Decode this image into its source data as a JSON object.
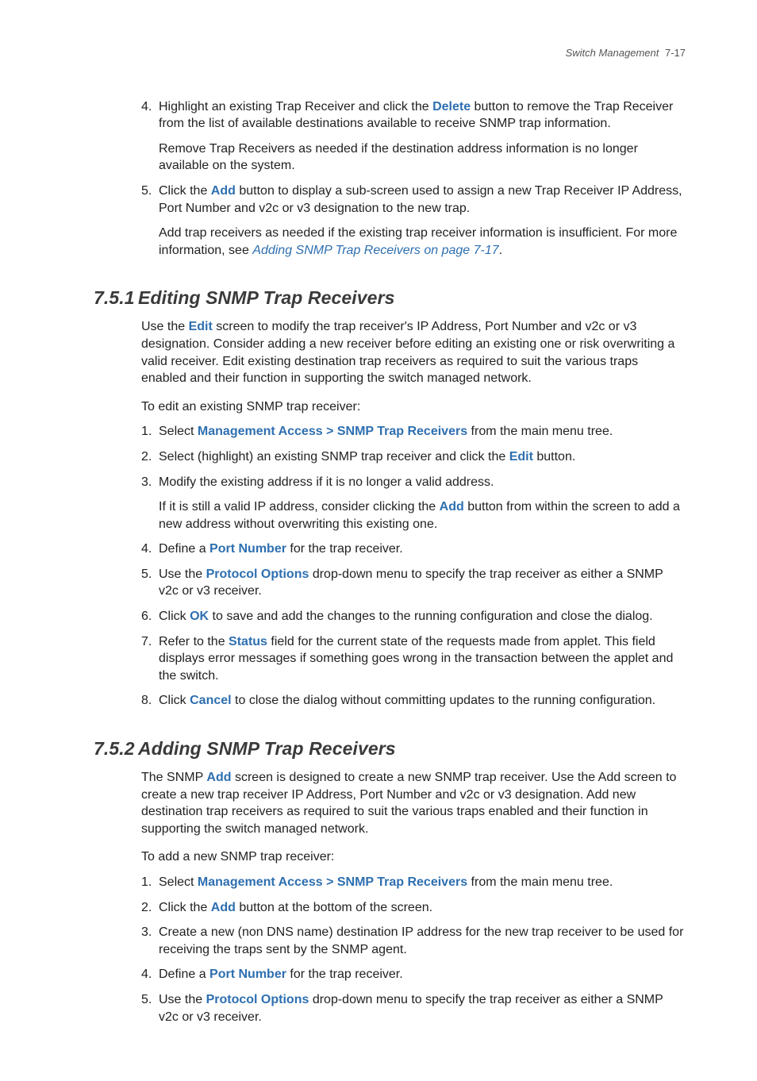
{
  "header": {
    "title": "Switch Management",
    "page": "7-17"
  },
  "topList": {
    "items": [
      {
        "num": "4.",
        "paragraphs": [
          [
            {
              "t": "Highlight an existing Trap Receiver and click the "
            },
            {
              "t": "Delete",
              "kw": true
            },
            {
              "t": " button to remove the Trap Receiver from the list of available destinations available to receive SNMP trap information."
            }
          ],
          [
            {
              "t": "Remove Trap Receivers as needed if the destination address information is no longer available on the system."
            }
          ]
        ]
      },
      {
        "num": "5.",
        "paragraphs": [
          [
            {
              "t": "Click the "
            },
            {
              "t": "Add",
              "kw": true
            },
            {
              "t": " button to display a sub-screen used to assign a new Trap Receiver IP Address, Port Number and v2c or v3 designation to the new trap."
            }
          ],
          [
            {
              "t": "Add trap receivers as needed if the existing trap receiver information is insufficient. For more information, see "
            },
            {
              "t": "Adding SNMP Trap Receivers on page 7-17",
              "xref": true
            },
            {
              "t": "."
            }
          ]
        ]
      }
    ]
  },
  "sec751": {
    "num": "7.5.1",
    "title": "Editing SNMP Trap Receivers",
    "leadSegs": [
      {
        "t": "Use the "
      },
      {
        "t": "Edit",
        "kw": true
      },
      {
        "t": " screen to modify the trap receiver's IP Address, Port Number and v2c or v3 designation. Consider adding a new receiver before editing an existing one or risk overwriting a valid receiver. Edit existing destination trap receivers as required to suit the various traps enabled and their function in supporting the switch managed network."
      }
    ],
    "intro": "To edit an existing SNMP trap receiver:",
    "items": [
      {
        "num": "1.",
        "paragraphs": [
          [
            {
              "t": "Select "
            },
            {
              "t": "Management Access > SNMP Trap Receivers",
              "kw": true
            },
            {
              "t": " from the main menu tree."
            }
          ]
        ]
      },
      {
        "num": "2.",
        "paragraphs": [
          [
            {
              "t": "Select (highlight) an existing SNMP trap receiver and click the "
            },
            {
              "t": "Edit",
              "kw": true
            },
            {
              "t": " button."
            }
          ]
        ]
      },
      {
        "num": "3.",
        "paragraphs": [
          [
            {
              "t": "Modify the existing address if it is no longer a valid address."
            }
          ],
          [
            {
              "t": "If it is still a valid IP address, consider clicking the "
            },
            {
              "t": "Add",
              "kw": true
            },
            {
              "t": " button from within the screen to add a new address without overwriting this existing one."
            }
          ]
        ]
      },
      {
        "num": "4.",
        "paragraphs": [
          [
            {
              "t": "Define a "
            },
            {
              "t": "Port Number",
              "kw": true
            },
            {
              "t": " for the trap receiver."
            }
          ]
        ]
      },
      {
        "num": "5.",
        "paragraphs": [
          [
            {
              "t": "Use the "
            },
            {
              "t": "Protocol Options",
              "kw": true
            },
            {
              "t": " drop-down menu to specify the trap receiver as either a SNMP v2c or v3 receiver."
            }
          ]
        ]
      },
      {
        "num": "6.",
        "paragraphs": [
          [
            {
              "t": "Click "
            },
            {
              "t": "OK",
              "kw": true
            },
            {
              "t": " to save and add the changes to the running configuration and close the dialog."
            }
          ]
        ]
      },
      {
        "num": "7.",
        "paragraphs": [
          [
            {
              "t": "Refer to the "
            },
            {
              "t": "Status",
              "kw": true
            },
            {
              "t": " field for the current state of the requests made from applet. This field displays error messages if something goes wrong in the transaction between the applet and the switch."
            }
          ]
        ]
      },
      {
        "num": "8.",
        "paragraphs": [
          [
            {
              "t": "Click "
            },
            {
              "t": "Cancel",
              "kw": true
            },
            {
              "t": " to close the dialog without committing updates to the running configuration."
            }
          ]
        ]
      }
    ]
  },
  "sec752": {
    "num": "7.5.2",
    "title": "Adding SNMP Trap Receivers",
    "leadSegs": [
      {
        "t": "The SNMP "
      },
      {
        "t": "Add",
        "kw": true
      },
      {
        "t": " screen is designed to create a new SNMP trap receiver. Use the Add screen to create a new trap receiver IP Address, Port Number and v2c or v3 designation. Add new destination trap receivers as required to suit the various traps enabled and their function in supporting the switch managed network."
      }
    ],
    "intro": "To add a new SNMP trap receiver:",
    "items": [
      {
        "num": "1.",
        "paragraphs": [
          [
            {
              "t": "Select "
            },
            {
              "t": "Management Access > SNMP Trap Receivers",
              "kw": true
            },
            {
              "t": " from the main menu tree."
            }
          ]
        ]
      },
      {
        "num": "2.",
        "paragraphs": [
          [
            {
              "t": "Click the "
            },
            {
              "t": "Add",
              "kw": true
            },
            {
              "t": " button at the bottom of the screen."
            }
          ]
        ]
      },
      {
        "num": "3.",
        "paragraphs": [
          [
            {
              "t": "Create a new (non DNS name) destination IP address for the new trap receiver to be used for receiving the traps sent by the SNMP agent."
            }
          ]
        ]
      },
      {
        "num": "4.",
        "paragraphs": [
          [
            {
              "t": "Define a "
            },
            {
              "t": "Port Number",
              "kw": true
            },
            {
              "t": " for the trap receiver."
            }
          ]
        ]
      },
      {
        "num": "5.",
        "paragraphs": [
          [
            {
              "t": "Use the "
            },
            {
              "t": "Protocol Options",
              "kw": true
            },
            {
              "t": " drop-down menu to specify the trap receiver as either a SNMP v2c or v3 receiver."
            }
          ]
        ]
      }
    ]
  }
}
